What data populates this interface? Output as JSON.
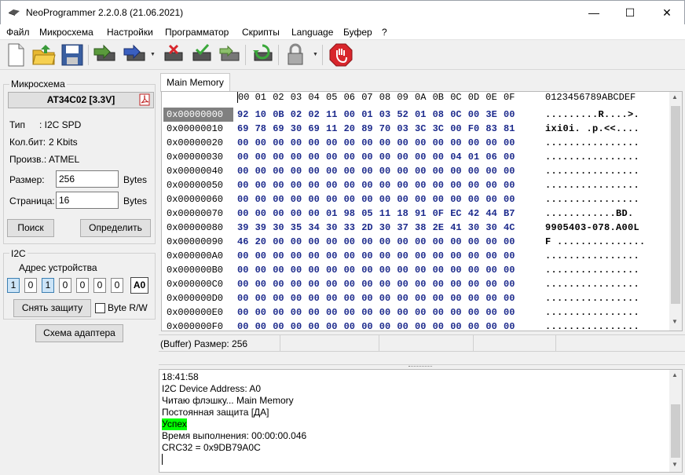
{
  "window": {
    "title": "NeoProgrammer 2.2.0.8 (21.06.2021)",
    "minimize": "—",
    "maximize": "☐",
    "close": "✕"
  },
  "menu": [
    "Файл",
    "Микросхема",
    "Настройки",
    "Программатор",
    "Скрипты",
    "Language",
    "Буфер",
    "?"
  ],
  "toolbar": {
    "icons": [
      "new-file-icon",
      "open-folder-icon",
      "save-disk-icon",
      "read-chip-icon",
      "write-chip-icon",
      "erase-chip-icon",
      "verify-chip-icon",
      "blank-check-icon",
      "auto-program-icon",
      "lock-icon",
      "stop-icon"
    ],
    "colors": {
      "chip_green": "#5a9a3c",
      "stop_red": "#d8262c",
      "chip_blue": "#3a5fbf"
    }
  },
  "chip": {
    "group_label": "Микросхема",
    "name": "AT34C02 [3.3V]",
    "type_label": "Тип",
    "type_value": ":   I2C SPD",
    "bits_label": "Кол.бит:",
    "bits_value": "2 Kbits",
    "maker_label": "Произв.:",
    "maker_value": "ATMEL",
    "size_label": "Размер:",
    "size_value": "256",
    "size_unit": "Bytes",
    "page_label": "Страница:",
    "page_value": "16",
    "page_unit": "Bytes",
    "search_button": "Поиск",
    "detect_button": "Определить"
  },
  "i2c": {
    "group_label": "I2C",
    "address_label": "Адрес устройства",
    "bits": [
      "1",
      "0",
      "1",
      "0",
      "0",
      "0",
      "0"
    ],
    "bits_on": [
      true,
      false,
      true,
      false,
      false,
      false,
      false
    ],
    "address_value": "A0",
    "unprotect_button": "Снять защиту",
    "byte_rw_label": "Byte R/W",
    "byte_rw_checked": false,
    "adapter_button": "Схема адаптера"
  },
  "tabs": [
    "Main Memory"
  ],
  "hex": {
    "columns": [
      "00",
      "01",
      "02",
      "03",
      "04",
      "05",
      "06",
      "07",
      "08",
      "09",
      "0A",
      "0B",
      "0C",
      "0D",
      "0E",
      "0F"
    ],
    "ascii_header": "0123456789ABCDEF",
    "rows": [
      {
        "addr": "0x00000000",
        "bytes": [
          "92",
          "10",
          "0B",
          "02",
          "02",
          "11",
          "00",
          "01",
          "03",
          "52",
          "01",
          "08",
          "0C",
          "00",
          "3E",
          "00"
        ],
        "ascii": ".........R....>."
      },
      {
        "addr": "0x00000010",
        "bytes": [
          "69",
          "78",
          "69",
          "30",
          "69",
          "11",
          "20",
          "89",
          "70",
          "03",
          "3C",
          "3C",
          "00",
          "F0",
          "83",
          "81"
        ],
        "ascii": "ixi0i. .p.<<...."
      },
      {
        "addr": "0x00000020",
        "bytes": [
          "00",
          "00",
          "00",
          "00",
          "00",
          "00",
          "00",
          "00",
          "00",
          "00",
          "00",
          "00",
          "00",
          "00",
          "00",
          "00"
        ],
        "ascii": "................"
      },
      {
        "addr": "0x00000030",
        "bytes": [
          "00",
          "00",
          "00",
          "00",
          "00",
          "00",
          "00",
          "00",
          "00",
          "00",
          "00",
          "00",
          "04",
          "01",
          "06",
          "00"
        ],
        "ascii": "................"
      },
      {
        "addr": "0x00000040",
        "bytes": [
          "00",
          "00",
          "00",
          "00",
          "00",
          "00",
          "00",
          "00",
          "00",
          "00",
          "00",
          "00",
          "00",
          "00",
          "00",
          "00"
        ],
        "ascii": "................"
      },
      {
        "addr": "0x00000050",
        "bytes": [
          "00",
          "00",
          "00",
          "00",
          "00",
          "00",
          "00",
          "00",
          "00",
          "00",
          "00",
          "00",
          "00",
          "00",
          "00",
          "00"
        ],
        "ascii": "................"
      },
      {
        "addr": "0x00000060",
        "bytes": [
          "00",
          "00",
          "00",
          "00",
          "00",
          "00",
          "00",
          "00",
          "00",
          "00",
          "00",
          "00",
          "00",
          "00",
          "00",
          "00"
        ],
        "ascii": "................"
      },
      {
        "addr": "0x00000070",
        "bytes": [
          "00",
          "00",
          "00",
          "00",
          "00",
          "01",
          "98",
          "05",
          "11",
          "18",
          "91",
          "0F",
          "EC",
          "42",
          "44",
          "B7"
        ],
        "ascii": "............BD."
      },
      {
        "addr": "0x00000080",
        "bytes": [
          "39",
          "39",
          "30",
          "35",
          "34",
          "30",
          "33",
          "2D",
          "30",
          "37",
          "38",
          "2E",
          "41",
          "30",
          "30",
          "4C"
        ],
        "ascii": "9905403-078.A00L"
      },
      {
        "addr": "0x00000090",
        "bytes": [
          "46",
          "20",
          "00",
          "00",
          "00",
          "00",
          "00",
          "00",
          "00",
          "00",
          "00",
          "00",
          "00",
          "00",
          "00",
          "00"
        ],
        "ascii": "F ..............."
      },
      {
        "addr": "0x000000A0",
        "bytes": [
          "00",
          "00",
          "00",
          "00",
          "00",
          "00",
          "00",
          "00",
          "00",
          "00",
          "00",
          "00",
          "00",
          "00",
          "00",
          "00"
        ],
        "ascii": "................"
      },
      {
        "addr": "0x000000B0",
        "bytes": [
          "00",
          "00",
          "00",
          "00",
          "00",
          "00",
          "00",
          "00",
          "00",
          "00",
          "00",
          "00",
          "00",
          "00",
          "00",
          "00"
        ],
        "ascii": "................"
      },
      {
        "addr": "0x000000C0",
        "bytes": [
          "00",
          "00",
          "00",
          "00",
          "00",
          "00",
          "00",
          "00",
          "00",
          "00",
          "00",
          "00",
          "00",
          "00",
          "00",
          "00"
        ],
        "ascii": "................"
      },
      {
        "addr": "0x000000D0",
        "bytes": [
          "00",
          "00",
          "00",
          "00",
          "00",
          "00",
          "00",
          "00",
          "00",
          "00",
          "00",
          "00",
          "00",
          "00",
          "00",
          "00"
        ],
        "ascii": "................"
      },
      {
        "addr": "0x000000E0",
        "bytes": [
          "00",
          "00",
          "00",
          "00",
          "00",
          "00",
          "00",
          "00",
          "00",
          "00",
          "00",
          "00",
          "00",
          "00",
          "00",
          "00"
        ],
        "ascii": "................"
      },
      {
        "addr": "0x000000F0",
        "bytes": [
          "00",
          "00",
          "00",
          "00",
          "00",
          "00",
          "00",
          "00",
          "00",
          "00",
          "00",
          "00",
          "00",
          "00",
          "00",
          "00"
        ],
        "ascii": "................"
      }
    ],
    "colors": {
      "byte": "#1c2a8c",
      "selected_addr_bg": "#808080"
    }
  },
  "status": {
    "buffer_size": "(Buffer) Размер: 256"
  },
  "log": {
    "lines": [
      {
        "text": "18:41:58",
        "highlight": false
      },
      {
        "text": "I2C Device Address: A0",
        "highlight": false
      },
      {
        "text": "Читаю флэшку... Main Memory",
        "highlight": false
      },
      {
        "text": "Постоянная защита [ДА]",
        "highlight": false
      },
      {
        "text": "Успех",
        "highlight": true
      },
      {
        "text": "Время выполнения: 00:00:00.046",
        "highlight": false
      },
      {
        "text": "CRC32 = 0x9DB79A0C",
        "highlight": false
      }
    ],
    "highlight_color": "#00ff00"
  }
}
